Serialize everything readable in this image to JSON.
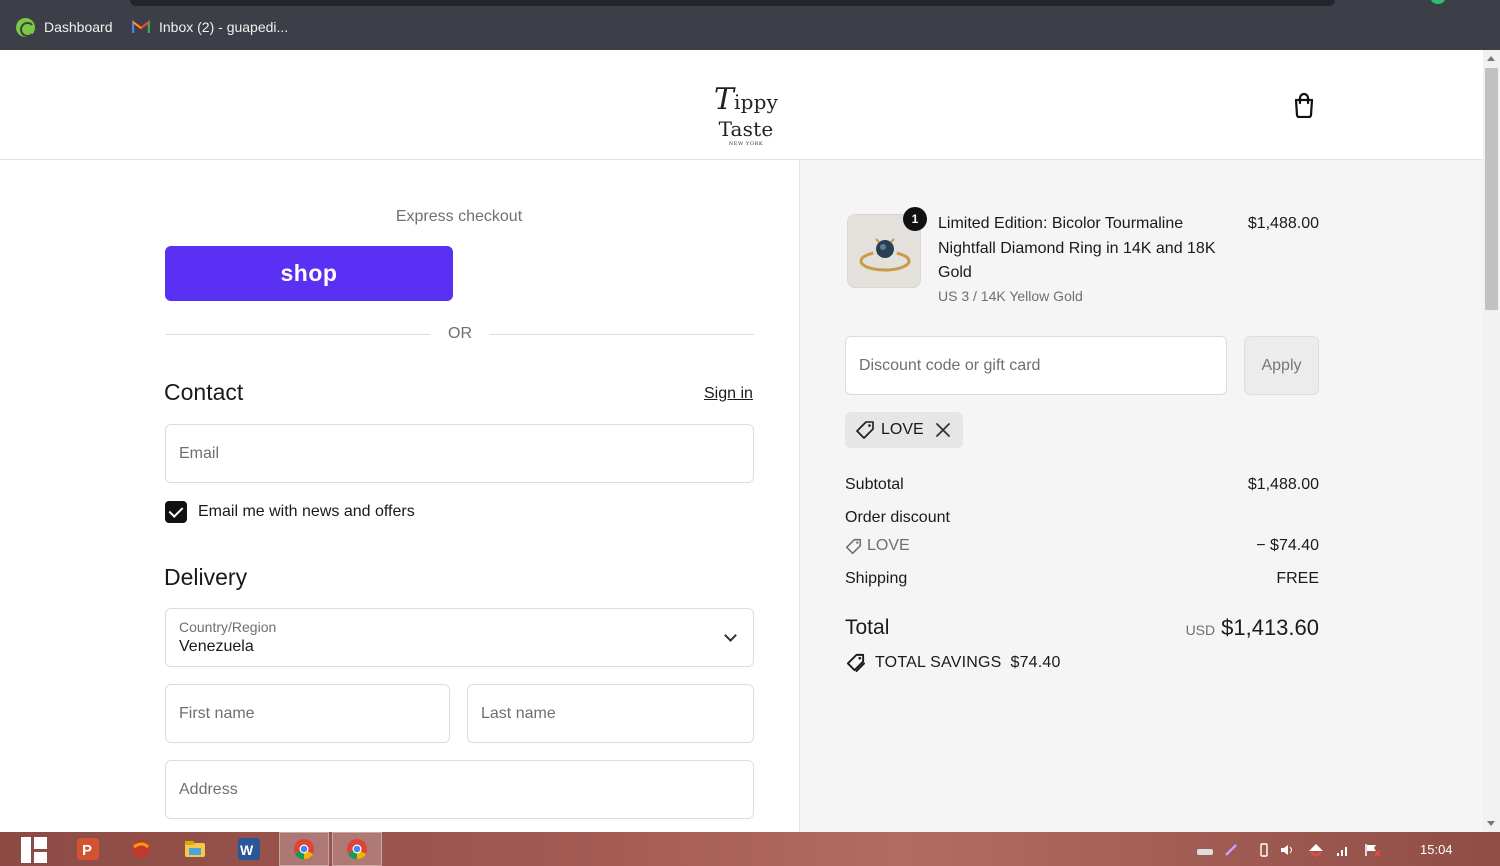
{
  "browser": {
    "bookmarks": [
      {
        "label": "Dashboard",
        "icon": "dashboard-icon"
      },
      {
        "label": "Inbox (2) - guapedi...",
        "icon": "gmail-icon"
      }
    ]
  },
  "header": {
    "logo_main": "Tippy Taste",
    "logo_first_letter": "T",
    "logo_rest": "ippy Taste",
    "logo_sub": "NEW YORK",
    "cart_icon": "shopping-bag-icon"
  },
  "express": {
    "title": "Express checkout",
    "shop_label": "shop",
    "shop_color": "#5a31f4",
    "or_label": "OR"
  },
  "contact": {
    "heading": "Contact",
    "sign_in": "Sign in",
    "email_placeholder": "Email",
    "newsletter_label": "Email me with news and offers",
    "newsletter_checked": true
  },
  "delivery": {
    "heading": "Delivery",
    "country_label": "Country/Region",
    "country_value": "Venezuela",
    "first_name_placeholder": "First name",
    "last_name_placeholder": "Last name",
    "address_placeholder": "Address"
  },
  "summary": {
    "product": {
      "quantity": "1",
      "name": "Limited Edition: Bicolor Tourmaline Nightfall Diamond Ring in 14K and 18K Gold",
      "variant": "US 3 / 14K Yellow Gold",
      "price": "$1,488.00"
    },
    "discount_placeholder": "Discount code or gift card",
    "apply_label": "Apply",
    "applied_code": "LOVE",
    "subtotal_label": "Subtotal",
    "subtotal_value": "$1,488.00",
    "order_discount_label": "Order discount",
    "discount_code": "LOVE",
    "discount_value": "− $74.40",
    "shipping_label": "Shipping",
    "shipping_value": "FREE",
    "total_label": "Total",
    "total_currency": "USD",
    "total_value": "$1,413.60",
    "savings_label": "TOTAL SAVINGS",
    "savings_value": "$74.40"
  },
  "taskbar": {
    "clock": "15:04"
  }
}
